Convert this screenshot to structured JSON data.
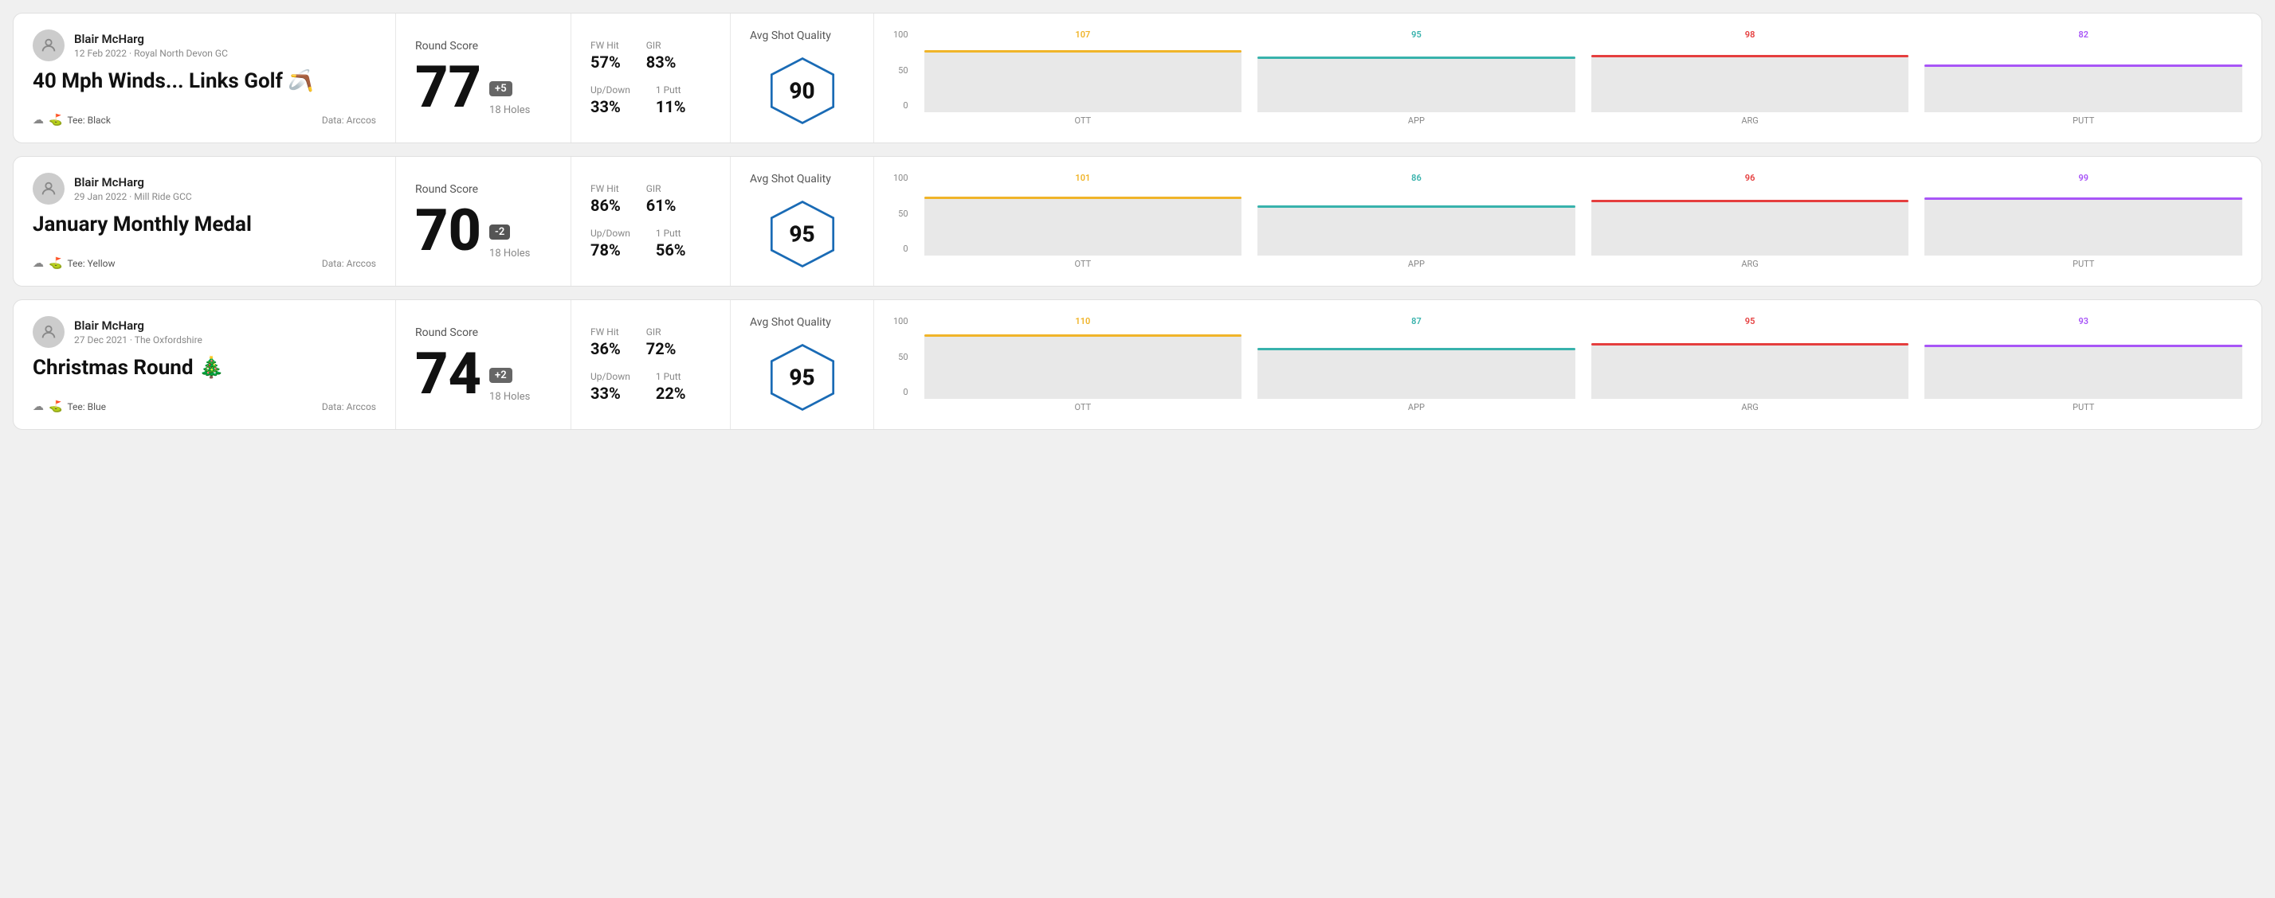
{
  "rounds": [
    {
      "id": "round-1",
      "player": {
        "name": "Blair McHarg",
        "date": "12 Feb 2022",
        "course": "Royal North Devon GC"
      },
      "title": "40 Mph Winds... Links Golf",
      "title_emoji": "🪃",
      "tee": "Black",
      "data_source": "Data: Arccos",
      "score": {
        "label": "Round Score",
        "value": "77",
        "badge": "+5",
        "badge_type": "over",
        "holes": "18 Holes"
      },
      "stats": {
        "fw_hit_label": "FW Hit",
        "fw_hit_value": "57%",
        "gir_label": "GIR",
        "gir_value": "83%",
        "updown_label": "Up/Down",
        "updown_value": "33%",
        "oneputt_label": "1 Putt",
        "oneputt_value": "11%"
      },
      "quality": {
        "label": "Avg Shot Quality",
        "value": "90"
      },
      "chart": {
        "bars": [
          {
            "label": "OTT",
            "value": 107,
            "color": "#f0b429",
            "max": 120
          },
          {
            "label": "APP",
            "value": 95,
            "color": "#38b2ac",
            "max": 120
          },
          {
            "label": "ARG",
            "value": 98,
            "color": "#e53e3e",
            "max": 120
          },
          {
            "label": "PUTT",
            "value": 82,
            "color": "#a855f7",
            "max": 120
          }
        ],
        "y_labels": [
          "100",
          "50",
          "0"
        ]
      }
    },
    {
      "id": "round-2",
      "player": {
        "name": "Blair McHarg",
        "date": "29 Jan 2022",
        "course": "Mill Ride GCC"
      },
      "title": "January Monthly Medal",
      "title_emoji": "",
      "tee": "Yellow",
      "data_source": "Data: Arccos",
      "score": {
        "label": "Round Score",
        "value": "70",
        "badge": "-2",
        "badge_type": "under",
        "holes": "18 Holes"
      },
      "stats": {
        "fw_hit_label": "FW Hit",
        "fw_hit_value": "86%",
        "gir_label": "GIR",
        "gir_value": "61%",
        "updown_label": "Up/Down",
        "updown_value": "78%",
        "oneputt_label": "1 Putt",
        "oneputt_value": "56%"
      },
      "quality": {
        "label": "Avg Shot Quality",
        "value": "95"
      },
      "chart": {
        "bars": [
          {
            "label": "OTT",
            "value": 101,
            "color": "#f0b429",
            "max": 120
          },
          {
            "label": "APP",
            "value": 86,
            "color": "#38b2ac",
            "max": 120
          },
          {
            "label": "ARG",
            "value": 96,
            "color": "#e53e3e",
            "max": 120
          },
          {
            "label": "PUTT",
            "value": 99,
            "color": "#a855f7",
            "max": 120
          }
        ],
        "y_labels": [
          "100",
          "50",
          "0"
        ]
      }
    },
    {
      "id": "round-3",
      "player": {
        "name": "Blair McHarg",
        "date": "27 Dec 2021",
        "course": "The Oxfordshire"
      },
      "title": "Christmas Round",
      "title_emoji": "🎄",
      "tee": "Blue",
      "data_source": "Data: Arccos",
      "score": {
        "label": "Round Score",
        "value": "74",
        "badge": "+2",
        "badge_type": "over",
        "holes": "18 Holes"
      },
      "stats": {
        "fw_hit_label": "FW Hit",
        "fw_hit_value": "36%",
        "gir_label": "GIR",
        "gir_value": "72%",
        "updown_label": "Up/Down",
        "updown_value": "33%",
        "oneputt_label": "1 Putt",
        "oneputt_value": "22%"
      },
      "quality": {
        "label": "Avg Shot Quality",
        "value": "95"
      },
      "chart": {
        "bars": [
          {
            "label": "OTT",
            "value": 110,
            "color": "#f0b429",
            "max": 120
          },
          {
            "label": "APP",
            "value": 87,
            "color": "#38b2ac",
            "max": 120
          },
          {
            "label": "ARG",
            "value": 95,
            "color": "#e53e3e",
            "max": 120
          },
          {
            "label": "PUTT",
            "value": 93,
            "color": "#a855f7",
            "max": 120
          }
        ],
        "y_labels": [
          "100",
          "50",
          "0"
        ]
      }
    }
  ]
}
